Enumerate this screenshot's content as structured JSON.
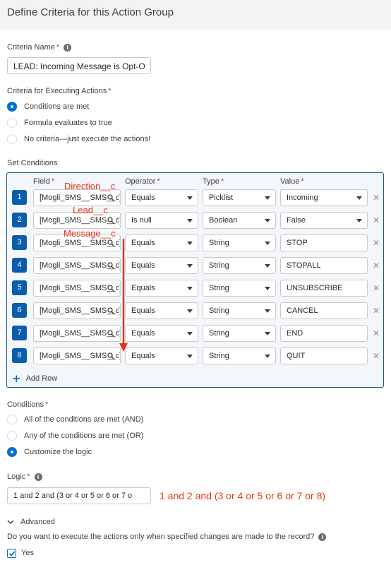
{
  "header": {
    "title": "Define Criteria for this Action Group"
  },
  "criteria_name": {
    "label": "Criteria Name",
    "value": "LEAD:  Incoming Message is Opt-O"
  },
  "execution": {
    "label": "Criteria for Executing Actions",
    "options": [
      "Conditions are met",
      "Formula evaluates to true",
      "No criteria—just execute the actions!"
    ],
    "selected": 0
  },
  "set_conditions": {
    "label": "Set Conditions",
    "columns": [
      "Field",
      "Operator",
      "Type",
      "Value"
    ],
    "rows": [
      {
        "num": "1",
        "field": "[Mogli_SMS__SMS__c].Direction__c",
        "operator": "Equals",
        "type": "Picklist",
        "value": "Incoming"
      },
      {
        "num": "2",
        "field": "[Mogli_SMS__SMS__c].Lead__c",
        "operator": "Is null",
        "type": "Boolean",
        "value": "False"
      },
      {
        "num": "3",
        "field": "[Mogli_SMS__SMS__c].Message__c",
        "operator": "Equals",
        "type": "String",
        "value": "STOP"
      },
      {
        "num": "4",
        "field": "[Mogli_SMS__SMS__c].Message__c",
        "operator": "Equals",
        "type": "String",
        "value": "STOPALL"
      },
      {
        "num": "5",
        "field": "[Mogli_SMS__SMS__c].Message__c",
        "operator": "Equals",
        "type": "String",
        "value": "UNSUBSCRIBE"
      },
      {
        "num": "6",
        "field": "[Mogli_SMS__SMS__c].Message__c",
        "operator": "Equals",
        "type": "String",
        "value": "CANCEL"
      },
      {
        "num": "7",
        "field": "[Mogli_SMS__SMS__c].Message__c",
        "operator": "Equals",
        "type": "String",
        "value": "END"
      },
      {
        "num": "8",
        "field": "[Mogli_SMS__SMS__c].Message__c",
        "operator": "Equals",
        "type": "String",
        "value": "QUIT"
      }
    ],
    "add_row_label": "Add Row",
    "annotations": [
      "Direction__c",
      "Lead__c",
      "Message__c"
    ]
  },
  "conditions": {
    "label": "Conditions",
    "options": [
      "All of the conditions are met (AND)",
      "Any of the conditions are met (OR)",
      "Customize the logic"
    ],
    "selected": 2
  },
  "logic": {
    "label": "Logic",
    "value": "1 and 2 and (3 or 4 or 5 or 6 or 7 o",
    "annotation": "1 and 2 and (3 or 4 or 5 or 6 or 7 or 8)"
  },
  "advanced": {
    "label": "Advanced",
    "question": "Do you want to execute the actions only when specified changes are made to the record?",
    "checkbox_label": "Yes",
    "checked": true
  },
  "colors": {
    "accent": "#0070d2",
    "row_badge": "#0b5cab",
    "annotation": "#e8341c",
    "required": "#c23934"
  }
}
